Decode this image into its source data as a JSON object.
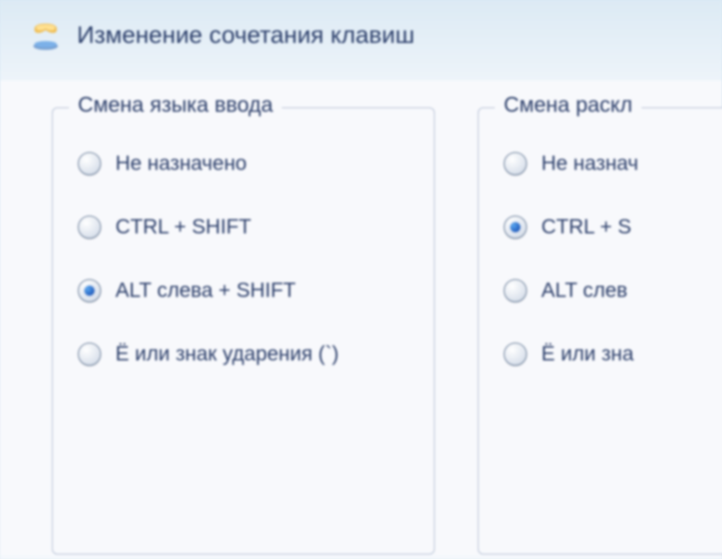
{
  "title": "Изменение сочетания клавиш",
  "left_group": {
    "title": "Смена языка ввода",
    "options": [
      {
        "label": "Не назначено",
        "selected": false
      },
      {
        "label": "CTRL + SHIFT",
        "selected": false
      },
      {
        "label": "ALT слева + SHIFT",
        "selected": true
      },
      {
        "label": "Ё или знак ударения (`)",
        "selected": false
      }
    ]
  },
  "right_group": {
    "title": "Смена раскл",
    "options": [
      {
        "label": "Не назнач",
        "selected": false
      },
      {
        "label": "CTRL + S",
        "selected": true
      },
      {
        "label": "ALT слев",
        "selected": false
      },
      {
        "label": "Ё или зна",
        "selected": false
      }
    ]
  }
}
